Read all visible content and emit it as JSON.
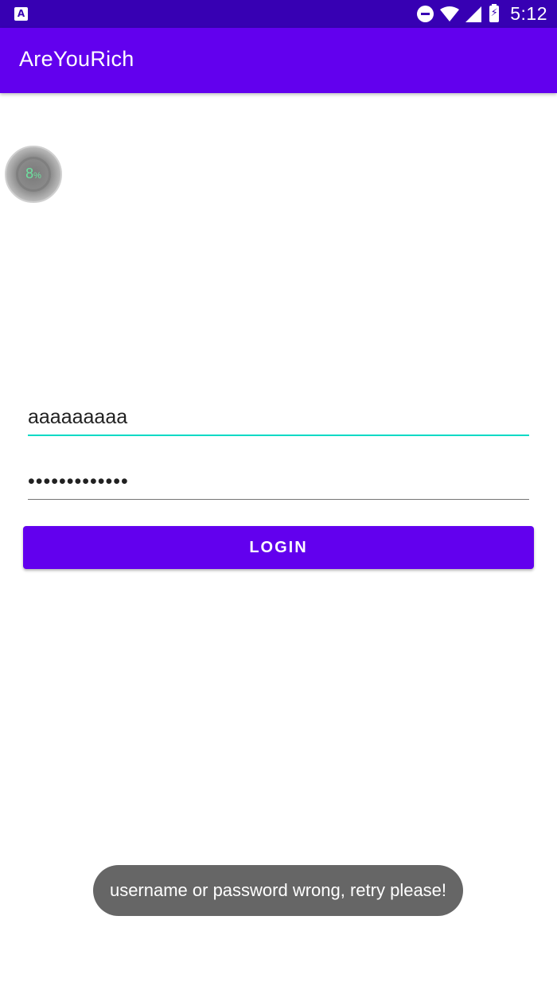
{
  "status_bar": {
    "left_icon": "app-notification-icon",
    "left_icon_glyph": "A",
    "icons": [
      "do-not-disturb-icon",
      "wifi-icon",
      "signal-icon",
      "battery-charging-icon"
    ],
    "battery_glyph": "⚡",
    "time": "5:12",
    "background_color": "#3700b3"
  },
  "app_bar": {
    "title": "AreYouRich",
    "background_color": "#6200ee"
  },
  "overlay_widget": {
    "value": "8",
    "unit": "%"
  },
  "login_form": {
    "username_value": "aaaaaaaaa",
    "password_value": "•••••••••••••",
    "login_label": "LOGIN",
    "accent_color": "#03dac5",
    "button_color": "#6200ee"
  },
  "toast": {
    "message": "username or password wrong, retry please!"
  }
}
